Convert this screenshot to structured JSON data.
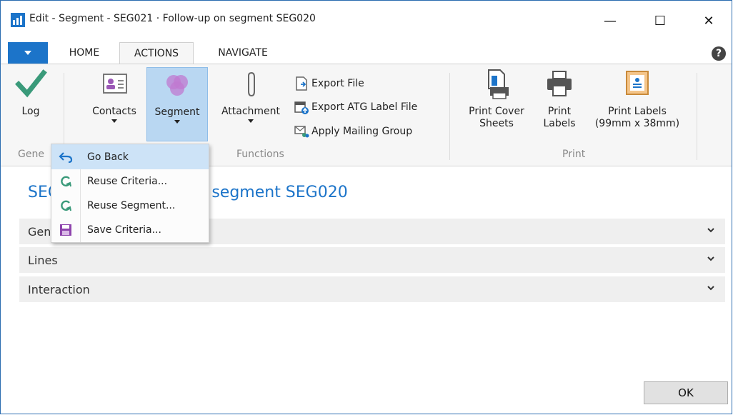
{
  "window": {
    "title": "Edit - Segment - SEG021 · Follow-up on segment SEG020",
    "minimize_glyph": "—",
    "maximize_glyph": "☐",
    "close_glyph": "✕"
  },
  "ribbon_tabs": {
    "file_icon": "caret-down-icon",
    "home": "HOME",
    "actions": "ACTIONS",
    "navigate": "NAVIGATE",
    "help": "?"
  },
  "ribbon": {
    "log": "Log",
    "contacts": "Contacts",
    "segment": "Segment",
    "attachment": "Attachment",
    "export_file": "Export File",
    "export_atg": "Export ATG Label File",
    "apply_mailing_group": "Apply Mailing Group",
    "print_cover_sheets_1": "Print Cover",
    "print_cover_sheets_2": "Sheets",
    "print_labels_1": "Print",
    "print_labels_2": "Labels",
    "print_labels_99_1": "Print Labels",
    "print_labels_99_2": "(99mm x 38mm)",
    "group_general": "Gene",
    "group_functions": "Functions",
    "group_print": "Print"
  },
  "menu": {
    "items": [
      {
        "label": "Go Back",
        "icon": "undo-arrow-icon"
      },
      {
        "label": "Reuse Criteria...",
        "icon": "refresh-icon"
      },
      {
        "label": "Reuse Segment...",
        "icon": "refresh-icon"
      },
      {
        "label": "Save Criteria...",
        "icon": "save-icon"
      }
    ]
  },
  "content": {
    "heading_left": "SEG",
    "heading_right": "on segment SEG020",
    "fasttabs": [
      {
        "label": "Gen"
      },
      {
        "label": "Lines"
      },
      {
        "label": "Interaction"
      }
    ]
  },
  "footer": {
    "ok": "OK"
  },
  "colors": {
    "accent": "#1c74c9",
    "highlight": "#b9d7f2",
    "check": "#3a9a7a",
    "segment_icon": "#b46fc8"
  }
}
